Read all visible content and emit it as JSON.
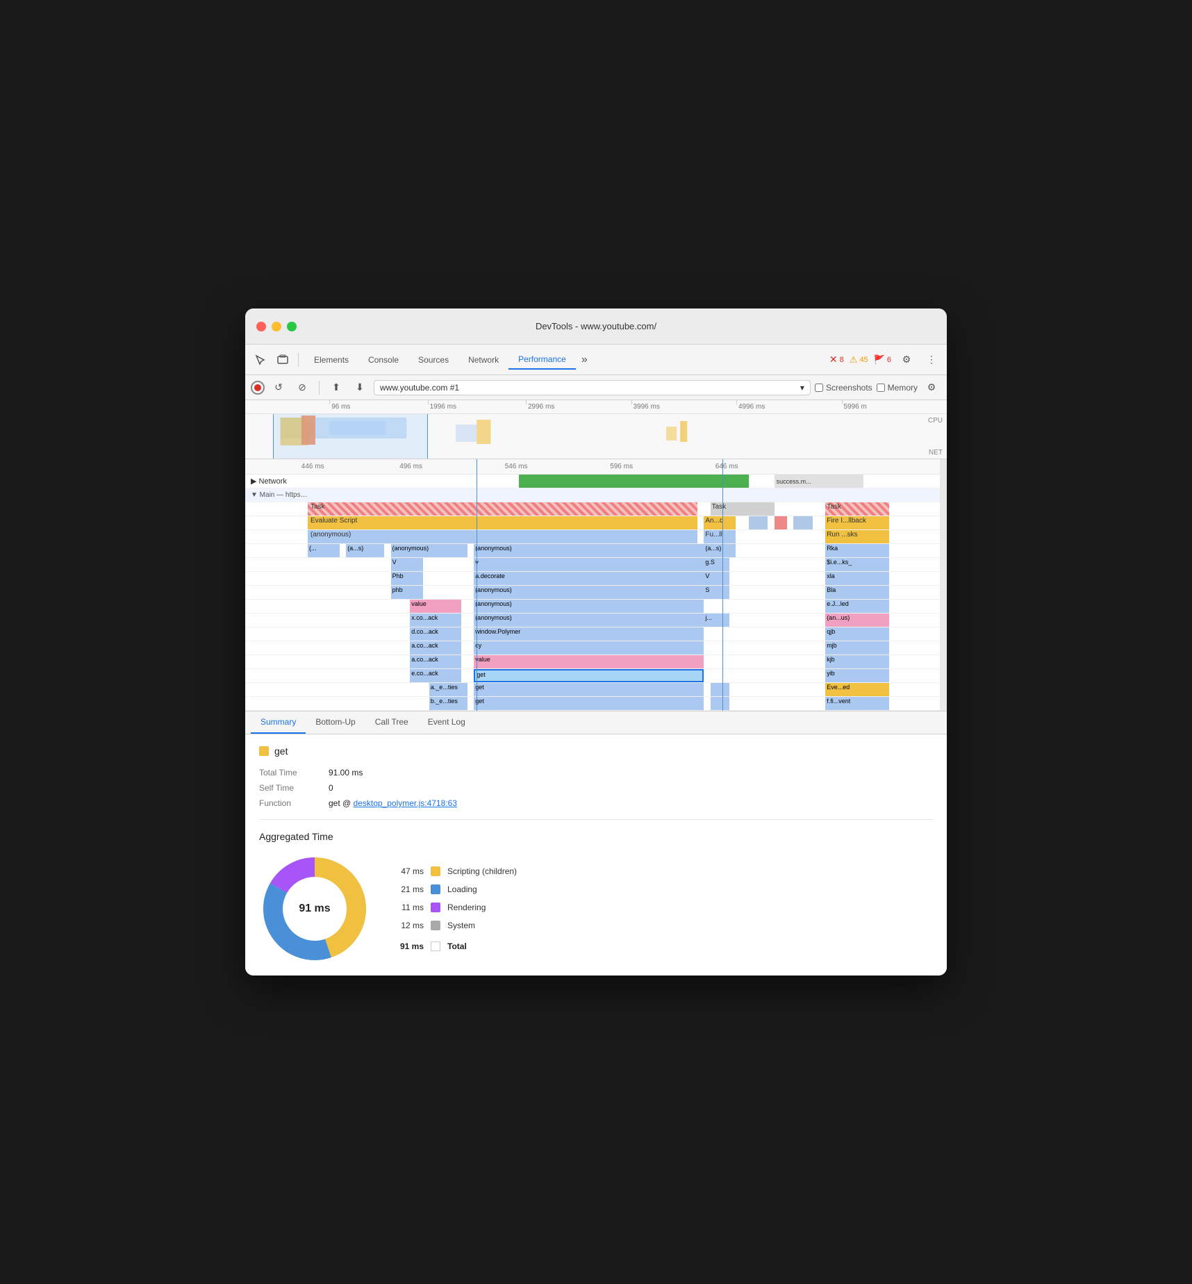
{
  "window": {
    "title": "DevTools - www.youtube.com/"
  },
  "traffic_lights": [
    "red",
    "yellow",
    "green"
  ],
  "toolbar": {
    "tabs": [
      {
        "label": "Elements",
        "active": false
      },
      {
        "label": "Console",
        "active": false
      },
      {
        "label": "Sources",
        "active": false
      },
      {
        "label": "Network",
        "active": false
      },
      {
        "label": "Performance",
        "active": true
      },
      {
        "label": "»",
        "active": false
      }
    ],
    "error_count": "8",
    "warn_count": "45",
    "info_count": "6"
  },
  "record_bar": {
    "url": "www.youtube.com #1",
    "screenshots_label": "Screenshots",
    "memory_label": "Memory"
  },
  "timeline": {
    "marks": [
      {
        "label": "96 ms",
        "left": "15%"
      },
      {
        "label": "1996 ms",
        "left": "28%"
      },
      {
        "label": "2996 ms",
        "left": "43%"
      },
      {
        "label": "3996 ms",
        "left": "58%"
      },
      {
        "label": "4996 ms",
        "left": "73%"
      },
      {
        "label": "5996 m",
        "left": "88%"
      }
    ],
    "cpu_label": "CPU",
    "net_label": "NET"
  },
  "flame_ruler": {
    "marks": [
      {
        "label": "446 ms",
        "left": "8%"
      },
      {
        "label": "496 ms",
        "left": "22%"
      },
      {
        "label": "546 ms",
        "left": "37%"
      },
      {
        "label": "596 ms",
        "left": "52%"
      },
      {
        "label": "646 ms",
        "left": "67%"
      }
    ]
  },
  "flame_rows": {
    "network_label": "▶ Network",
    "main_label": "▼ Main — https://www.youtube.com/",
    "success_label": "success.m...",
    "rows": [
      {
        "label": "Task",
        "blocks": [
          {
            "text": "Task",
            "left": "0%",
            "width": "60%",
            "color": "#f5a0a0",
            "striped": true
          },
          {
            "text": "Task",
            "left": "62%",
            "width": "12%",
            "color": "#e0e0e0"
          },
          {
            "text": "Task",
            "left": "80%",
            "width": "12%",
            "color": "#f5a0a0",
            "striped": true
          }
        ]
      },
      {
        "label": "Evaluate Script",
        "blocks": [
          {
            "text": "Evaluate Script",
            "left": "0%",
            "width": "60%",
            "color": "#f0c040"
          },
          {
            "text": "An...d",
            "left": "61%",
            "width": "5%",
            "color": "#f0c040"
          },
          {
            "text": "Fire I...llback",
            "left": "80%",
            "width": "12%",
            "color": "#f0c040"
          }
        ]
      },
      {
        "label": "(anonymous)",
        "blocks": [
          {
            "text": "(anonymous)",
            "left": "0%",
            "width": "60%",
            "color": "#aac8f0"
          },
          {
            "text": "Fu...ll",
            "left": "61%",
            "width": "5%",
            "color": "#aac8f0"
          },
          {
            "text": "Run ...sks",
            "left": "80%",
            "width": "12%",
            "color": "#f0c040"
          }
        ]
      }
    ]
  },
  "bottom_tabs": [
    {
      "label": "Summary",
      "active": true
    },
    {
      "label": "Bottom-Up",
      "active": false
    },
    {
      "label": "Call Tree",
      "active": false
    },
    {
      "label": "Event Log",
      "active": false
    }
  ],
  "summary": {
    "title": "get",
    "color": "#f0c040",
    "total_time_label": "Total Time",
    "total_time_value": "91.00 ms",
    "self_time_label": "Self Time",
    "self_time_value": "0",
    "function_label": "Function",
    "function_prefix": "get @ ",
    "function_link": "desktop_polymer.js:4718:63"
  },
  "aggregated": {
    "title": "Aggregated Time",
    "donut_label": "91 ms",
    "items": [
      {
        "ms": "47 ms",
        "color": "#f0c040",
        "label": "Scripting (children)"
      },
      {
        "ms": "21 ms",
        "color": "#4a90d9",
        "label": "Loading"
      },
      {
        "ms": "11 ms",
        "color": "#a855f7",
        "label": "Rendering"
      },
      {
        "ms": "12 ms",
        "color": "#aaaaaa",
        "label": "System"
      }
    ],
    "total": {
      "ms": "91 ms",
      "label": "Total"
    }
  },
  "icons": {
    "cursor": "⌖",
    "screenshot": "⊡",
    "record": "●",
    "reload": "↺",
    "clear": "⊘",
    "upload": "⬆",
    "download": "⬇",
    "settings": "⚙",
    "more": "⋮",
    "gear2": "⚙"
  }
}
